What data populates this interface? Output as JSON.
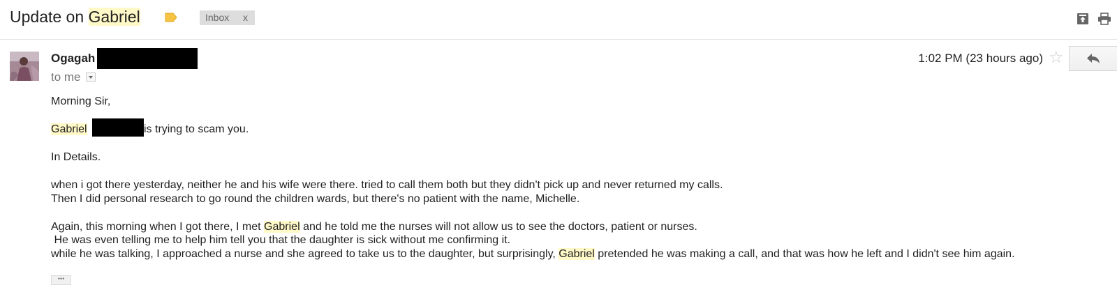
{
  "thread": {
    "subject_prefix": "Update on ",
    "subject_name": "Gabriel",
    "label_icon": "label-tag-icon",
    "label_color": "#f6c342",
    "chip": {
      "label": "Inbox",
      "close": "x"
    },
    "toolbar_icons": [
      "archive-up-icon",
      "print-icon"
    ]
  },
  "message": {
    "sender_name": "Ogagah",
    "recipient_text": "to me",
    "timestamp": "1:02 PM (23 hours ago)",
    "body": {
      "greeting": "Morning Sir,",
      "line2_name": "Gabriel",
      "line2_rest": "is trying to scam you.",
      "line3": "In Details.",
      "line4": "when i got there yesterday, neither he and his wife were there. tried to call them both but they didn't pick up and never returned my calls.",
      "line5": "Then I did personal research to go round the children wards, but there's no patient with the name, Michelle.",
      "line6_pre": "Again, this morning when I got there, I met ",
      "line6_name": "Gabriel",
      "line6_post": " and he told me the nurses will not allow us to see the doctors, patient or nurses.",
      "line7": " He was even telling me to help him tell you that the daughter is sick without me confirming it.",
      "line8_pre": "while he was talking, I approached a nurse and she agreed to take us to the daughter, but surprisingly, ",
      "line8_name": "Gabriel",
      "line8_post": " pretended he was making a call, and that was how he left and I didn't see him again."
    },
    "trimmed_content_label": "•••"
  },
  "colors": {
    "highlight": "#fff8c7",
    "chip_bg": "#dddddd",
    "secondary_text": "#777777"
  }
}
